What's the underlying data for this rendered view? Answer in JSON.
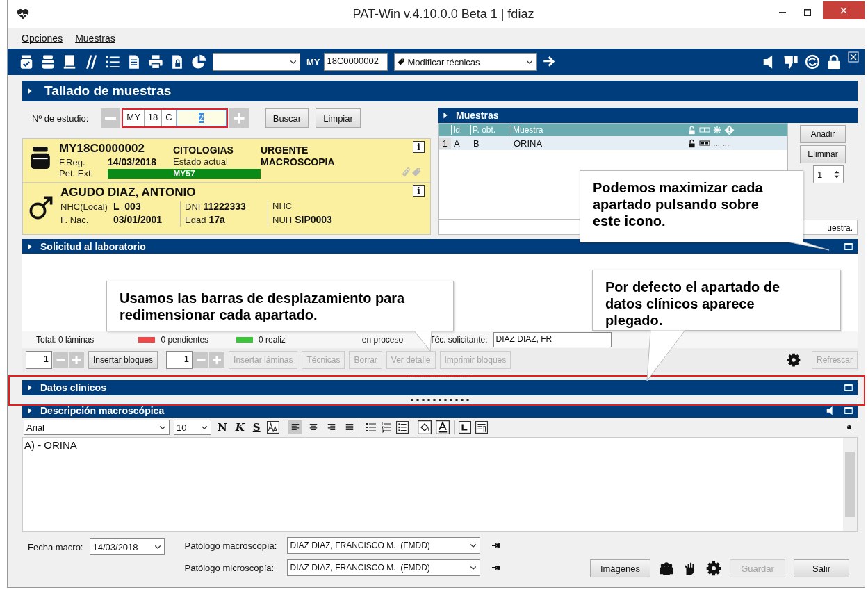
{
  "window": {
    "title": "PAT-Win v.4.10.0.0 Beta 1 | fdiaz"
  },
  "menu": [
    {
      "label": "Opciones"
    },
    {
      "label": "Muestras"
    }
  ],
  "toolbar": {
    "study_prefix": "MY",
    "study_code": "18C0000002",
    "action": "Modificar técnicas"
  },
  "tallado": {
    "title": "Tallado de muestras",
    "study_label": "Nº de estudio:",
    "study_parts": [
      "MY",
      "18",
      "C",
      "2"
    ],
    "buttons": [
      "Buscar",
      "Limpiar"
    ]
  },
  "case": {
    "code": "MY18C0000002",
    "type": "CITOLOGIAS",
    "priority": "URGENTE",
    "freg_label": "F.Reg.",
    "freg": "14/03/2018",
    "state_label": "Estado actual",
    "state": "MACROSCOPIA",
    "pet_label": "Pet. Ext.",
    "pet": "MY57",
    "info": "i"
  },
  "patient": {
    "name": "AGUDO DIAZ, ANTONIO",
    "info": "i",
    "fields": [
      {
        "label": "NHC(Local)",
        "value": "L_003"
      },
      {
        "label": "F. Nac.",
        "value": "03/01/2001"
      },
      {
        "label": "DNI",
        "value": "11222333"
      },
      {
        "label": "Edad",
        "value": "17a"
      },
      {
        "label": "NHC"
      },
      {
        "label": "NUH",
        "value": "SIP0003"
      }
    ]
  },
  "muestras": {
    "title": "Muestras",
    "columns": [
      "Id",
      "P. obt.",
      "Muestra"
    ],
    "rows": [
      {
        "num": "1",
        "id": "A",
        "p_obt": "B",
        "muestra": "ORINA",
        "marks": "... ..."
      }
    ],
    "buttons": [
      "Añadir",
      "Eliminar"
    ],
    "spin_value": "1",
    "footer": "uestra."
  },
  "solicitud": {
    "title": "Solicitud al laboratorio",
    "total": "Total: 0 láminas",
    "legend": [
      {
        "color": "#f04848",
        "label": "0 pendientes"
      },
      {
        "color": "#3cc43c",
        "label": "0 realiz"
      },
      {
        "label": "en proceso"
      }
    ],
    "tecnico_label": "Téc. solicitante:",
    "tecnico": "DIAZ DIAZ, FR",
    "controls": [
      {
        "kind": "spin",
        "value": "1"
      },
      {
        "kind": "button",
        "label": "Insertar bloques",
        "disabled": false
      },
      {
        "kind": "spin",
        "value": "1"
      },
      {
        "kind": "button",
        "label": "Insertar láminas",
        "disabled": true
      },
      {
        "kind": "button",
        "label": "Técnicas",
        "disabled": true
      },
      {
        "kind": "button",
        "label": "Borrar",
        "disabled": true
      },
      {
        "kind": "button",
        "label": "Ver detalle",
        "disabled": true
      },
      {
        "kind": "button",
        "label": "Imprimir bloques",
        "disabled": true
      }
    ],
    "refresh": {
      "label": "Refrescar",
      "disabled": true
    }
  },
  "datos_clinicos": {
    "title": "Datos clínicos",
    "expanded": false
  },
  "descripcion": {
    "title": "Descripción macroscópica",
    "font": "Arial",
    "size": "10",
    "format_buttons": [
      {
        "label": "N"
      },
      {
        "label": "K"
      },
      {
        "label": "S"
      }
    ],
    "alignment": [
      {
        "selected": true
      },
      {
        "selected": false
      },
      {
        "selected": false
      },
      {
        "selected": false
      }
    ],
    "text": "A) - ORINA"
  },
  "footer": {
    "fecha_label": "Fecha macro:",
    "fecha": "14/03/2018",
    "pat_macro_label": "Patólogo macroscopía:",
    "pat_macro": "DIAZ DIAZ, FRANCISCO M.  (FMDD)",
    "pat_micro_label": "Patólogo microscopía:",
    "pat_micro": "DIAZ DIAZ, FRANCISCO M.  (FMDD)",
    "buttons": [
      {
        "label": "Imágenes",
        "disabled": false
      },
      {
        "label": "Guardar",
        "disabled": true
      },
      {
        "label": "Salir",
        "disabled": false
      }
    ]
  },
  "callouts": [
    {
      "text": "Podemos maximizar cada apartado pulsando sobre este icono."
    },
    {
      "text": "Usamos las barras de desplazamiento para redimensionar cada apartado."
    },
    {
      "text": "Por defecto el apartado de datos clínicos aparece plegado."
    }
  ]
}
